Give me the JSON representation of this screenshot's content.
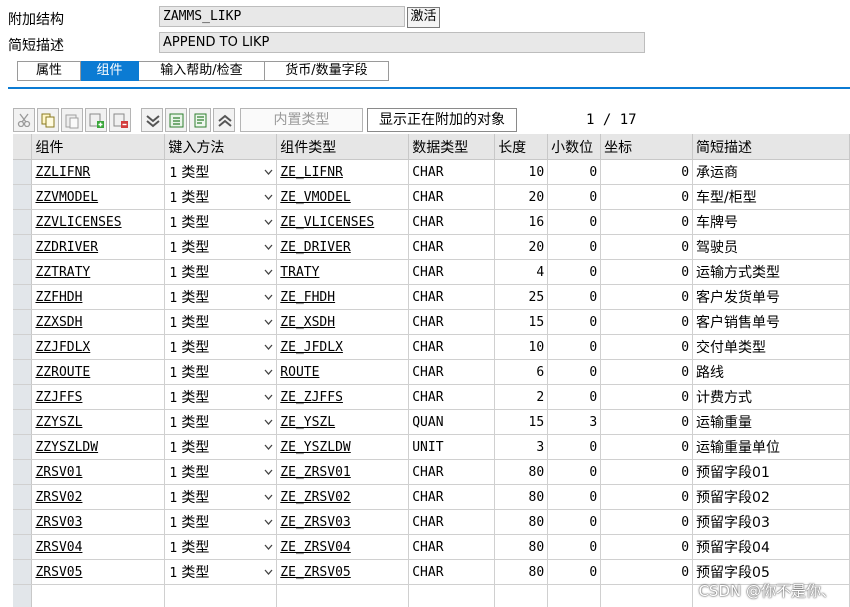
{
  "header": {
    "append_struct_label": "附加结构",
    "append_struct_value": "ZAMMS_LIKP",
    "activate_label": "激活",
    "short_desc_label": "简短描述",
    "short_desc_value": "APPEND TO LIKP"
  },
  "tabs": [
    {
      "label": "属性"
    },
    {
      "label": "组件"
    },
    {
      "label": "输入帮助/检查"
    },
    {
      "label": "货币/数量字段"
    }
  ],
  "toolbar": {
    "builtin_type_label": "内置类型",
    "show_appended_label": "显示正在附加的对象",
    "pager": "1 / 17"
  },
  "table": {
    "columns": [
      "组件",
      "键入方法",
      "组件类型",
      "数据类型",
      "长度",
      "小数位",
      "坐标",
      "简短描述"
    ],
    "rows": [
      {
        "comp": "ZZLIFNR",
        "method": "1",
        "method_label": "类型",
        "ctype": "ZE_LIFNR",
        "dtype": "CHAR",
        "len": "10",
        "dec": "0",
        "coord": "0",
        "desc": "承运商"
      },
      {
        "comp": "ZZVMODEL",
        "method": "1",
        "method_label": "类型",
        "ctype": "ZE_VMODEL",
        "dtype": "CHAR",
        "len": "20",
        "dec": "0",
        "coord": "0",
        "desc": "车型/柜型"
      },
      {
        "comp": "ZZVLICENSES",
        "method": "1",
        "method_label": "类型",
        "ctype": "ZE_VLICENSES",
        "dtype": "CHAR",
        "len": "16",
        "dec": "0",
        "coord": "0",
        "desc": "车牌号"
      },
      {
        "comp": "ZZDRIVER",
        "method": "1",
        "method_label": "类型",
        "ctype": "ZE_DRIVER",
        "dtype": "CHAR",
        "len": "20",
        "dec": "0",
        "coord": "0",
        "desc": "驾驶员"
      },
      {
        "comp": "ZZTRATY",
        "method": "1",
        "method_label": "类型",
        "ctype": "TRATY",
        "dtype": "CHAR",
        "len": "4",
        "dec": "0",
        "coord": "0",
        "desc": "运输方式类型"
      },
      {
        "comp": "ZZFHDH",
        "method": "1",
        "method_label": "类型",
        "ctype": "ZE_FHDH",
        "dtype": "CHAR",
        "len": "25",
        "dec": "0",
        "coord": "0",
        "desc": "客户发货单号"
      },
      {
        "comp": "ZZXSDH",
        "method": "1",
        "method_label": "类型",
        "ctype": "ZE_XSDH",
        "dtype": "CHAR",
        "len": "15",
        "dec": "0",
        "coord": "0",
        "desc": "客户销售单号"
      },
      {
        "comp": "ZZJFDLX",
        "method": "1",
        "method_label": "类型",
        "ctype": "ZE_JFDLX",
        "dtype": "CHAR",
        "len": "10",
        "dec": "0",
        "coord": "0",
        "desc": "交付单类型"
      },
      {
        "comp": "ZZROUTE",
        "method": "1",
        "method_label": "类型",
        "ctype": "ROUTE",
        "dtype": "CHAR",
        "len": "6",
        "dec": "0",
        "coord": "0",
        "desc": "路线"
      },
      {
        "comp": "ZZJFFS",
        "method": "1",
        "method_label": "类型",
        "ctype": "ZE_ZJFFS",
        "dtype": "CHAR",
        "len": "2",
        "dec": "0",
        "coord": "0",
        "desc": "计费方式"
      },
      {
        "comp": "ZZYSZL",
        "method": "1",
        "method_label": "类型",
        "ctype": "ZE_YSZL",
        "dtype": "QUAN",
        "len": "15",
        "dec": "3",
        "coord": "0",
        "desc": "运输重量"
      },
      {
        "comp": "ZZYSZLDW",
        "method": "1",
        "method_label": "类型",
        "ctype": "ZE_YSZLDW",
        "dtype": "UNIT",
        "len": "3",
        "dec": "0",
        "coord": "0",
        "desc": "运输重量单位"
      },
      {
        "comp": "ZRSV01",
        "method": "1",
        "method_label": "类型",
        "ctype": "ZE_ZRSV01",
        "dtype": "CHAR",
        "len": "80",
        "dec": "0",
        "coord": "0",
        "desc": "预留字段01"
      },
      {
        "comp": "ZRSV02",
        "method": "1",
        "method_label": "类型",
        "ctype": "ZE_ZRSV02",
        "dtype": "CHAR",
        "len": "80",
        "dec": "0",
        "coord": "0",
        "desc": "预留字段02"
      },
      {
        "comp": "ZRSV03",
        "method": "1",
        "method_label": "类型",
        "ctype": "ZE_ZRSV03",
        "dtype": "CHAR",
        "len": "80",
        "dec": "0",
        "coord": "0",
        "desc": "预留字段03"
      },
      {
        "comp": "ZRSV04",
        "method": "1",
        "method_label": "类型",
        "ctype": "ZE_ZRSV04",
        "dtype": "CHAR",
        "len": "80",
        "dec": "0",
        "coord": "0",
        "desc": "预留字段04"
      },
      {
        "comp": "ZRSV05",
        "method": "1",
        "method_label": "类型",
        "ctype": "ZE_ZRSV05",
        "dtype": "CHAR",
        "len": "80",
        "dec": "0",
        "coord": "0",
        "desc": "预留字段05"
      }
    ]
  },
  "watermark": "CSDN @你不是你、",
  "colors": {
    "accent": "#0b7bd3",
    "header_bg": "#e6e6e6",
    "field_bg": "#e8e8e8"
  }
}
